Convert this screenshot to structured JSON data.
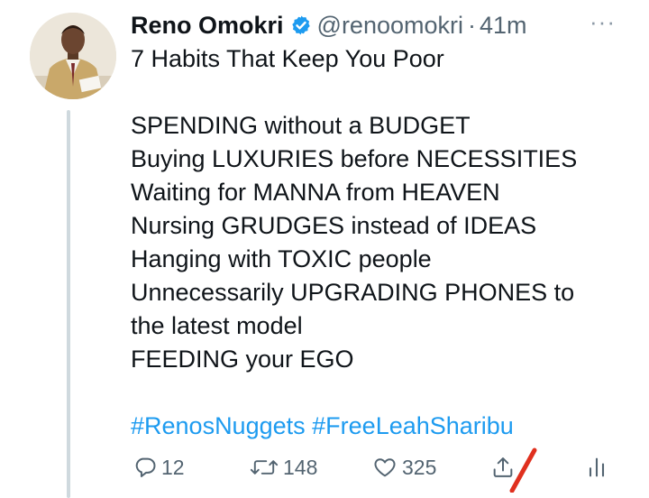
{
  "tweet": {
    "author_name": "Reno Omokri",
    "handle": "@renoomokri",
    "separator": "·",
    "time": "41m",
    "more_label": "···",
    "verified": true,
    "body_lines": [
      "7 Habits That Keep You Poor",
      "",
      "SPENDING without a BUDGET",
      "Buying LUXURIES before NECESSITIES",
      "Waiting for MANNA from HEAVEN",
      "Nursing GRUDGES instead of IDEAS",
      "Hanging with TOXIC people",
      "Unnecessarily UPGRADING PHONES to",
      "the latest model",
      "FEEDING your EGO"
    ],
    "hashtags": [
      "#RenosNuggets",
      "#FreeLeahSharibu"
    ],
    "actions": {
      "reply_count": "12",
      "retweet_count": "148",
      "like_count": "325"
    }
  },
  "colors": {
    "accent": "#1d9bf0",
    "text": "#0f1419",
    "muted": "#536471",
    "thread_line": "#cfd9de",
    "annotation_mark": "#e0301e"
  },
  "icons": [
    "verified-badge-icon",
    "more-icon",
    "reply-icon",
    "retweet-icon",
    "like-icon",
    "share-icon",
    "analytics-icon"
  ]
}
